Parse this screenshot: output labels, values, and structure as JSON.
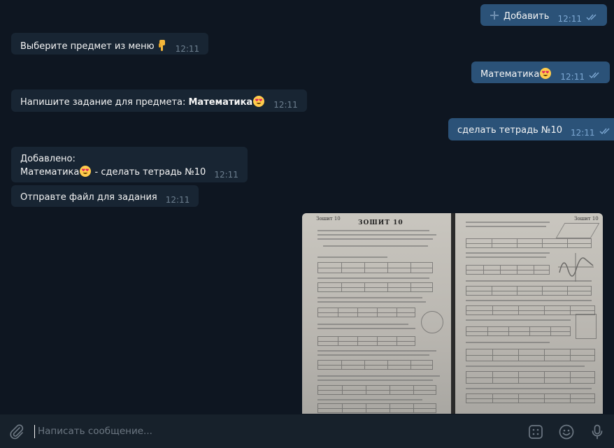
{
  "messages": [
    {
      "id": "m1",
      "direction": "out",
      "icon": "plus-icon",
      "text": "Добавить",
      "time": "12:11"
    },
    {
      "id": "m2",
      "direction": "in",
      "text": "Выберите предмет из меню",
      "emoji": "pointing-down-hand",
      "time": "12:11"
    },
    {
      "id": "m3",
      "direction": "out",
      "text": "Математика",
      "emoji": "heart-eyes",
      "time": "12:11"
    },
    {
      "id": "m4",
      "direction": "in",
      "text": "Напишите задание для предмета: ",
      "bold": "Математика",
      "emoji": "heart-eyes",
      "time": "12:11"
    },
    {
      "id": "m5",
      "direction": "out",
      "text": "сделать тетрадь №10",
      "time": "12:11"
    },
    {
      "id": "m6",
      "direction": "in",
      "line1": "Добавлено:",
      "line2_a": "Математика",
      "line2_b": " - сделать тетрадь №10",
      "emoji": "heart-eyes",
      "time": "12:11"
    },
    {
      "id": "m7",
      "direction": "in",
      "text": "Отправте файл для задания",
      "time": "12:11"
    },
    {
      "id": "m8",
      "direction": "out",
      "type": "photo",
      "page_left_header": "Зошит 10",
      "page_left_title": "ЗОШИТ 10",
      "page_right_header": "Зошит 10"
    }
  ],
  "composer": {
    "placeholder": "Написать сообщение...",
    "icons": [
      "paperclip-icon",
      "bot-commands-icon",
      "emoji-icon",
      "microphone-icon"
    ]
  },
  "colors": {
    "background": "#0e1621",
    "incoming": "#182533",
    "outgoing": "#2b5278",
    "composer": "#17212b"
  }
}
